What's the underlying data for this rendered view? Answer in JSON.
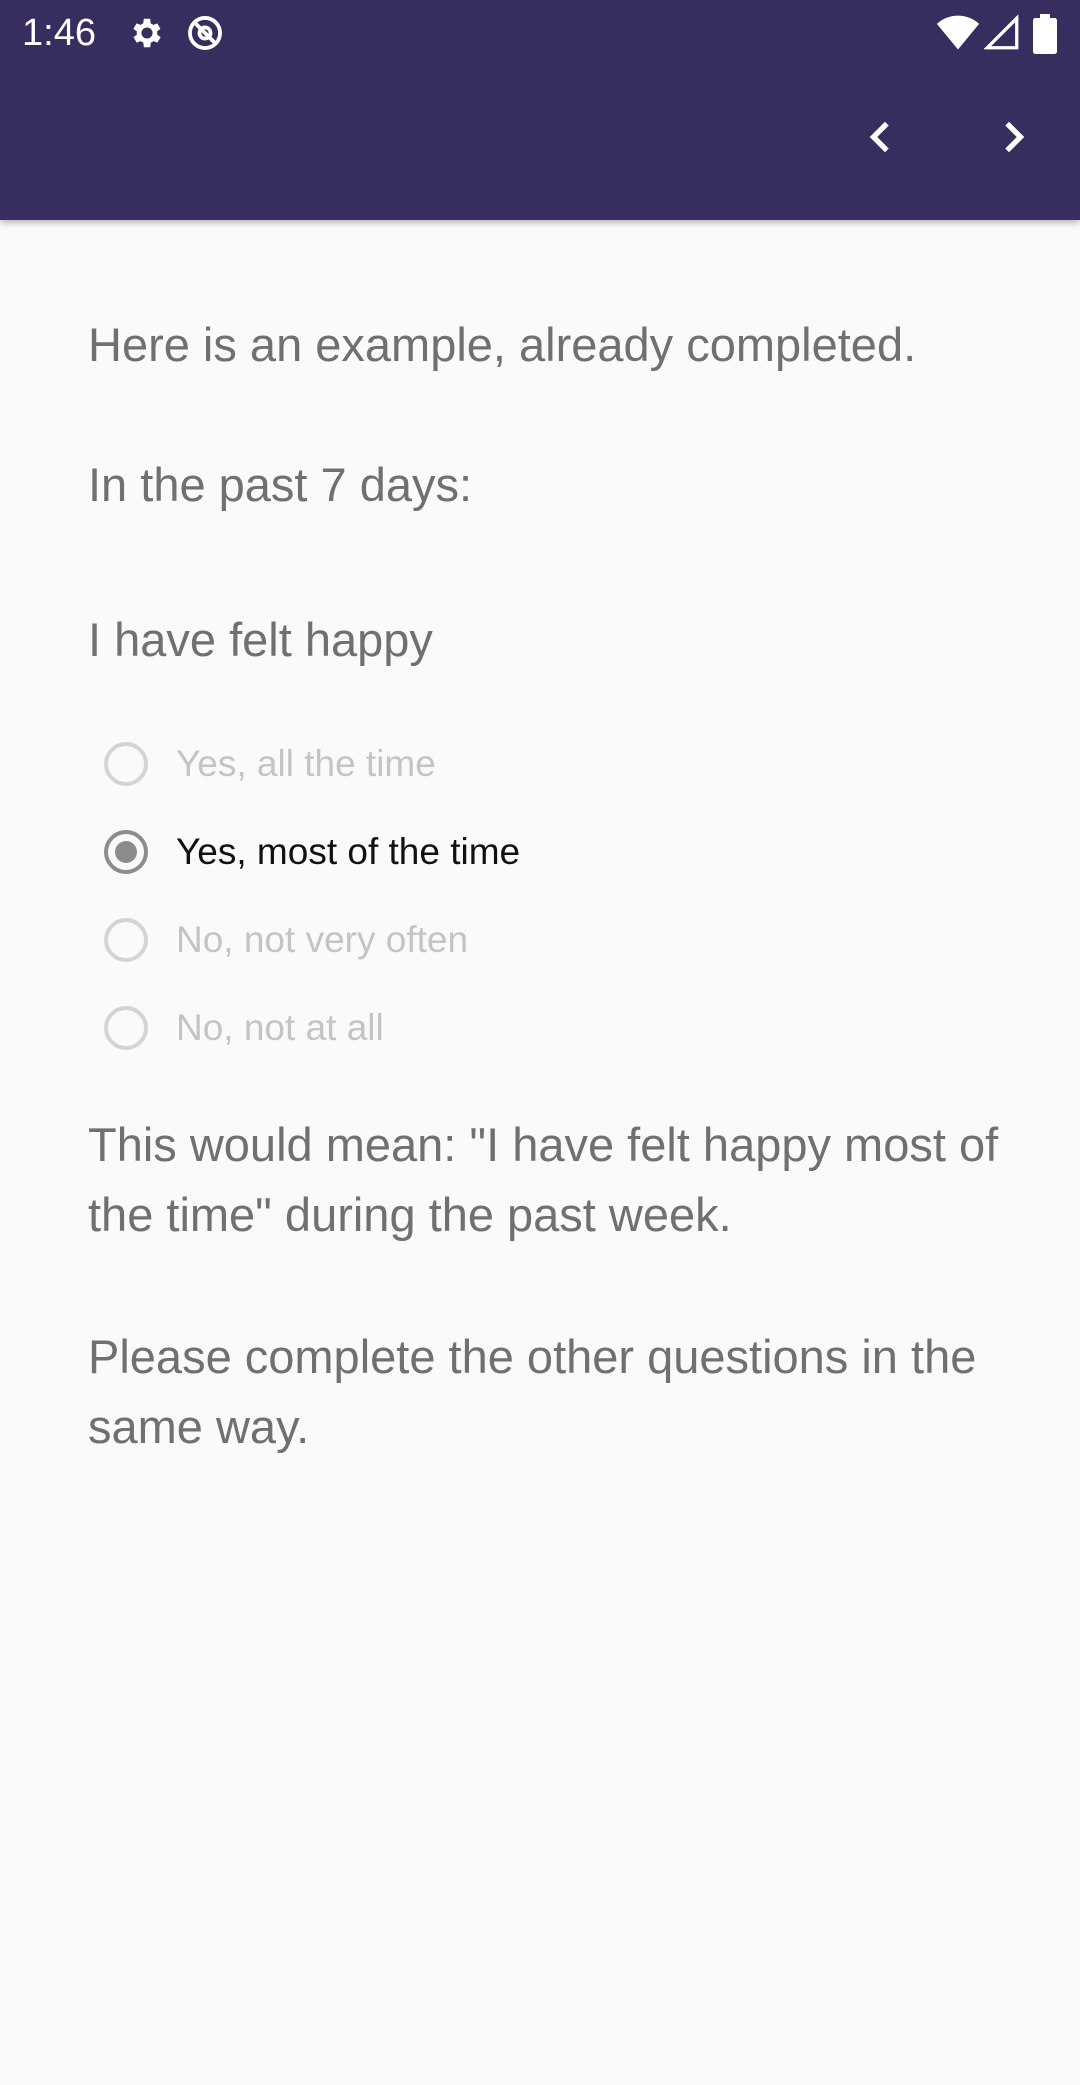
{
  "status_bar": {
    "time": "1:46",
    "icons_left": [
      "gear-icon",
      "at-sign-icon"
    ],
    "icons_right": [
      "wifi-icon",
      "cell-signal-icon",
      "battery-icon"
    ]
  },
  "toolbar": {
    "prev_icon": "chevron-left-icon",
    "next_icon": "chevron-right-icon",
    "color": "#372d5f"
  },
  "content": {
    "intro": "Here is an example, already completed.",
    "period": "In the past 7 days:",
    "question": "I have felt happy",
    "options": [
      {
        "label": "Yes, all the time",
        "selected": false
      },
      {
        "label": "Yes, most of the time",
        "selected": true
      },
      {
        "label": "No, not very often",
        "selected": false
      },
      {
        "label": "No, not at all",
        "selected": false
      }
    ],
    "explanation": "This would mean: \"I have felt happy most of the time\" during the past week.",
    "instruction": "Please complete the other questions in the same way."
  }
}
